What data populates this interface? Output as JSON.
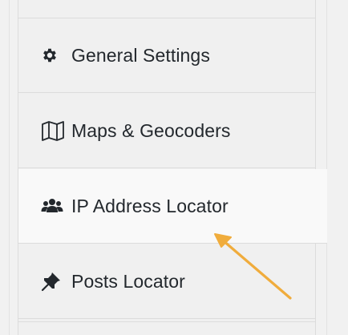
{
  "nav": {
    "items": [
      {
        "label": "General Settings",
        "icon": "gear-icon"
      },
      {
        "label": "Maps & Geocoders",
        "icon": "map-icon"
      },
      {
        "label": "IP Address Locator",
        "icon": "users-icon",
        "active": true
      },
      {
        "label": "Posts Locator",
        "icon": "pin-icon"
      }
    ]
  },
  "annotation": {
    "arrow_color": "#f0ac3c",
    "arrow_target": "IP Address Locator"
  },
  "colors": {
    "panel_bg": "#f0f0f0",
    "active_bg": "#f9f9f9",
    "text": "#23282d",
    "border": "#dcdcdc"
  }
}
